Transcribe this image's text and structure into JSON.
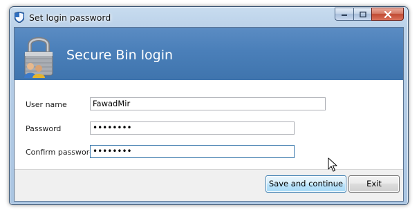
{
  "window": {
    "title": "Set login password",
    "icons": {
      "app": "shield-icon",
      "banner": "padlock-users-icon",
      "cursor": "mouse-pointer-icon"
    }
  },
  "banner": {
    "title": "Secure Bin login"
  },
  "form": {
    "username": {
      "label": "User name",
      "value": "FawadMir"
    },
    "password": {
      "label": "Password",
      "value": "••••••••"
    },
    "confirm": {
      "label": "Confirm password",
      "value": "••••••••"
    }
  },
  "buttons": {
    "save": "Save and continue",
    "exit": "Exit"
  },
  "colors": {
    "banner": "#4a7fb9",
    "close": "#c9503a",
    "focus_border": "#3d7bad"
  }
}
